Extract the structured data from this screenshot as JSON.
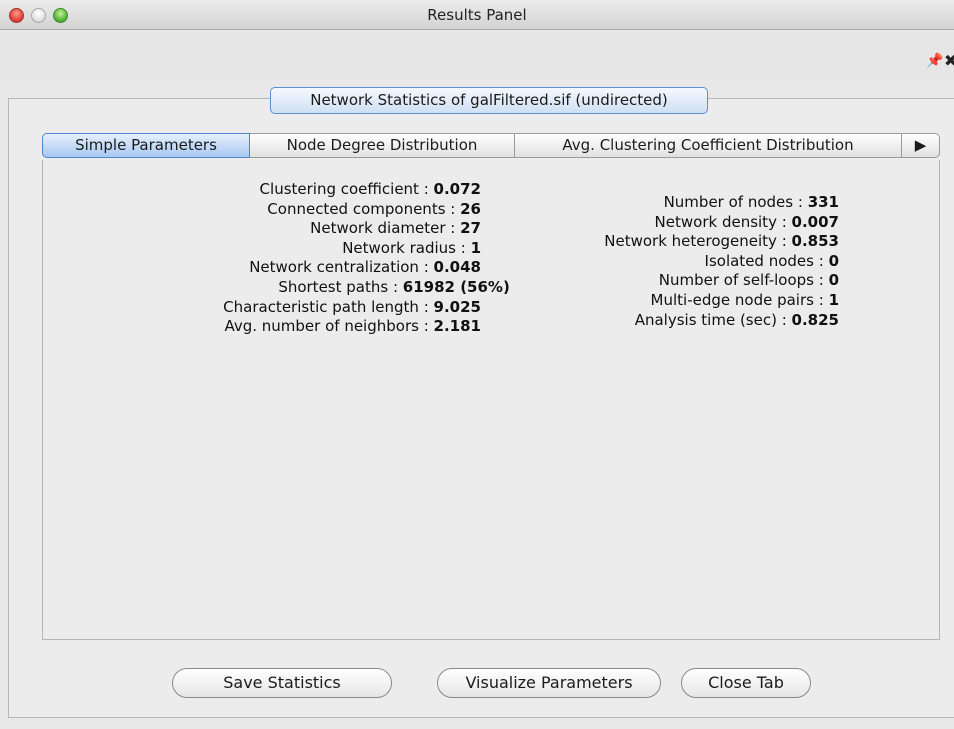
{
  "window": {
    "title": "Results Panel"
  },
  "toolbar": {
    "pin_glyph": "❖",
    "close_glyph": "✖"
  },
  "panel": {
    "header": "Network Statistics of galFiltered.sif (undirected)"
  },
  "tabs": [
    {
      "label": "Simple Parameters",
      "active": true
    },
    {
      "label": "Node Degree Distribution",
      "active": false
    },
    {
      "label": "Avg. Clustering Coefficient Distribution",
      "active": false
    }
  ],
  "tab_scroll_glyph": "▶",
  "left_stats": [
    {
      "label": "Clustering coefficient :",
      "value": "0.072"
    },
    {
      "label": "Connected components :",
      "value": "26"
    },
    {
      "label": "Network diameter :",
      "value": "27"
    },
    {
      "label": "Network radius :",
      "value": "1"
    },
    {
      "label": "Network centralization :",
      "value": "0.048"
    },
    {
      "label": "Shortest paths :",
      "value": "61982 (56%)"
    },
    {
      "label": "Characteristic path length :",
      "value": "9.025"
    },
    {
      "label": "Avg. number of neighbors :",
      "value": "2.181"
    }
  ],
  "right_stats": [
    {
      "label": "Number of nodes :",
      "value": "331"
    },
    {
      "label": "Network density :",
      "value": "0.007"
    },
    {
      "label": "Network heterogeneity :",
      "value": "0.853"
    },
    {
      "label": "Isolated nodes :",
      "value": "0"
    },
    {
      "label": "Number of self-loops :",
      "value": "0"
    },
    {
      "label": "Multi-edge node pairs :",
      "value": "1"
    },
    {
      "label": "Analysis time (sec) :",
      "value": "0.825"
    }
  ],
  "buttons": {
    "save": "Save Statistics",
    "visualize": "Visualize Parameters",
    "close": "Close Tab"
  },
  "colors": {
    "active_tab": "#a6c8f0",
    "header_border": "#5d8ecf",
    "close_light": "#e0443b",
    "zoom_light": "#55b93a"
  }
}
